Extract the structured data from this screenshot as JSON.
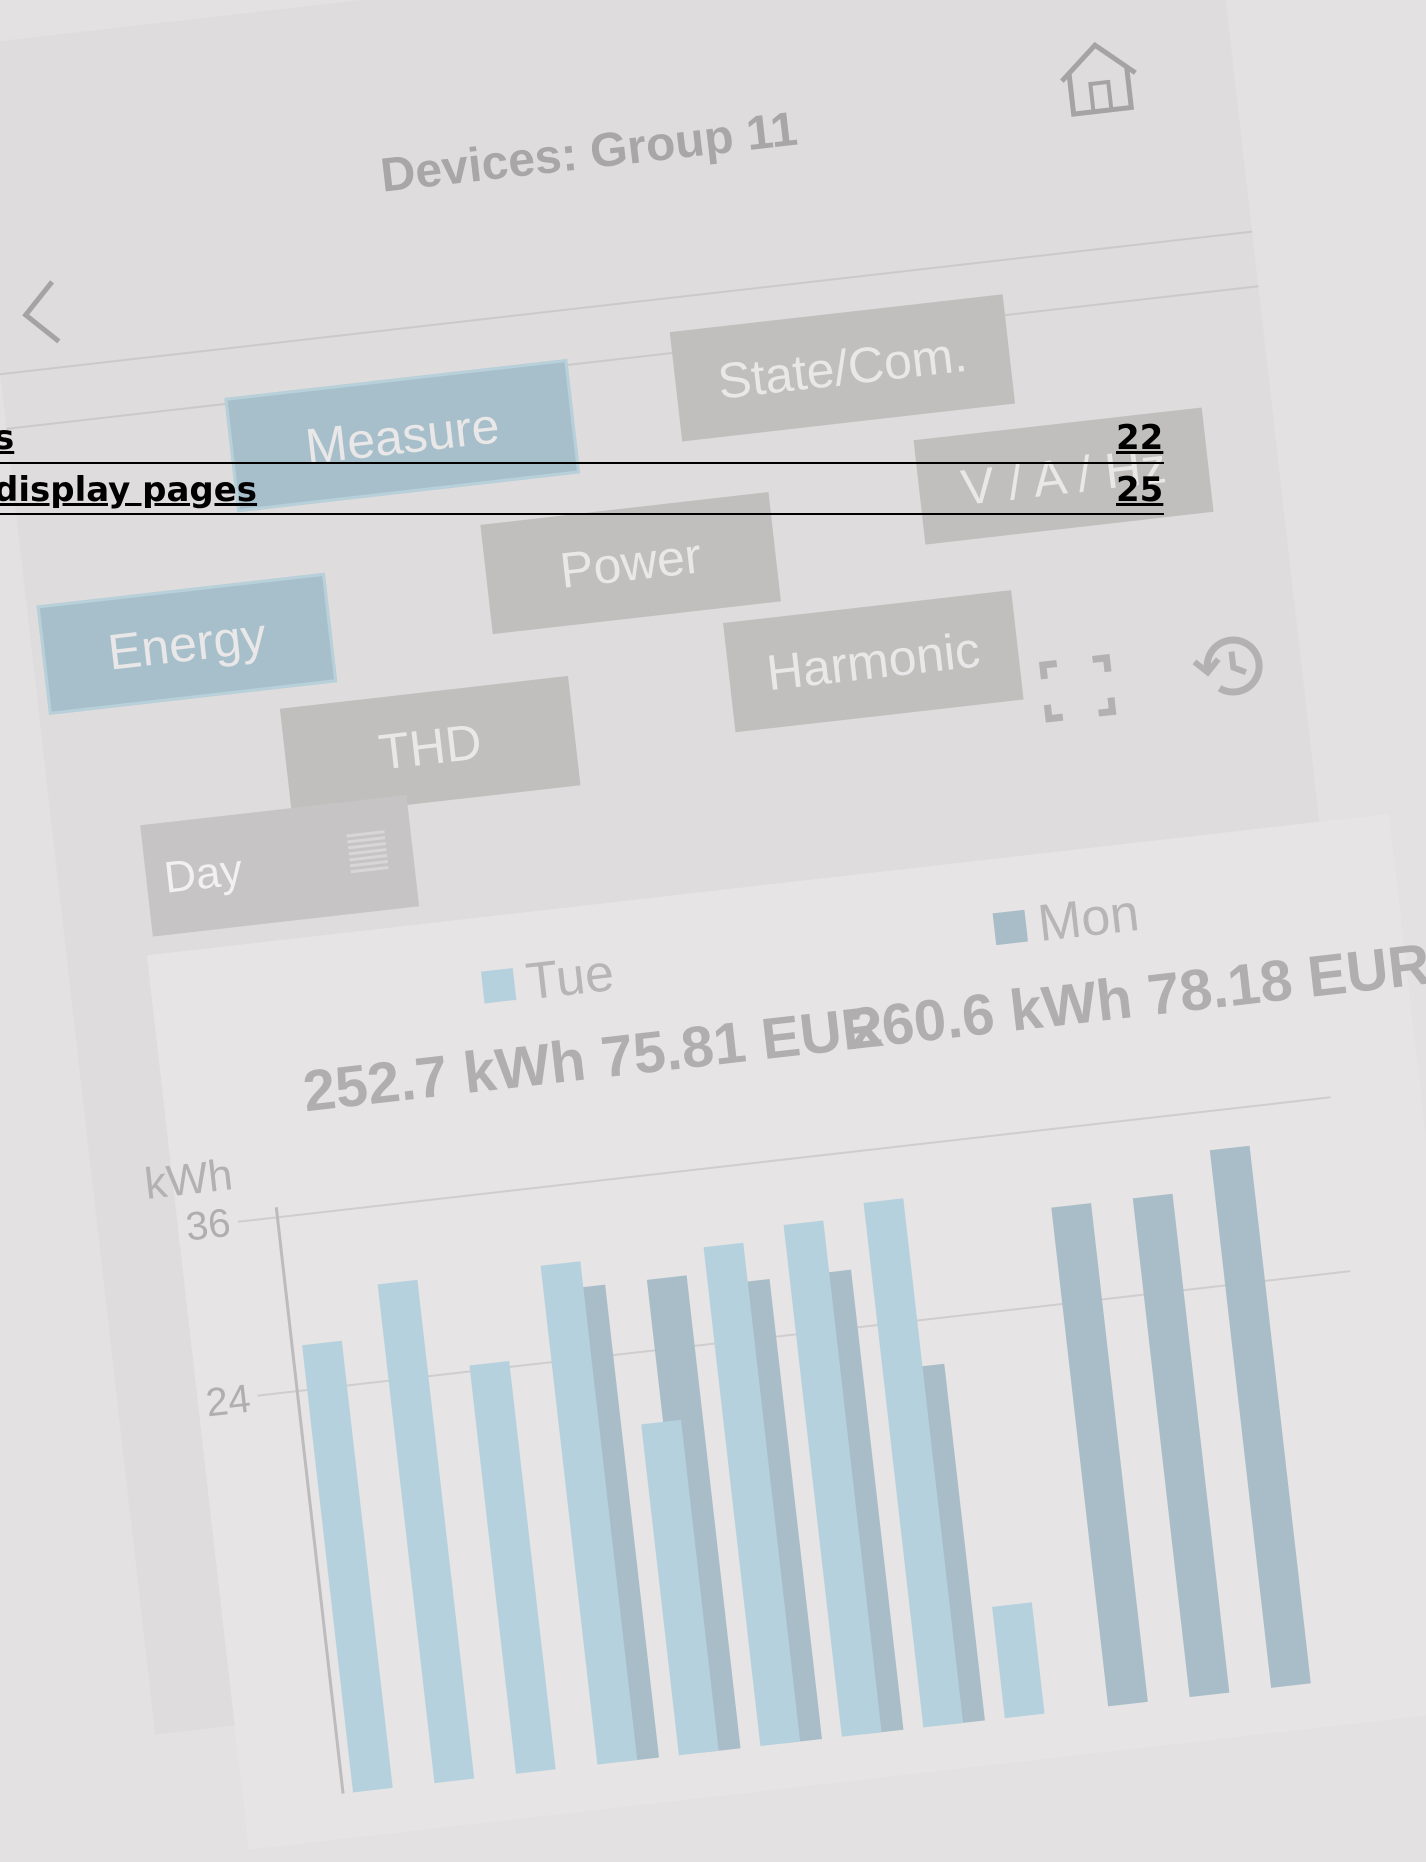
{
  "header": {
    "title": "Devices: Group 11",
    "back_icon": "chevron-left-icon",
    "home_icon": "home-icon"
  },
  "tabs": [
    {
      "label": "Measure",
      "active": true
    },
    {
      "label": "State/Com.",
      "active": false
    },
    {
      "label": "V / A / Hz",
      "active": false
    },
    {
      "label": "Power",
      "active": false
    },
    {
      "label": "Energy",
      "active": true
    },
    {
      "label": "Harmonic",
      "active": false
    },
    {
      "label": "THD",
      "active": false
    }
  ],
  "tools": {
    "fullscreen_icon": "fullscreen-icon",
    "history_icon": "history-icon"
  },
  "period": {
    "label": "Day",
    "icon": "list-icon"
  },
  "legend": [
    {
      "label": "Tue",
      "total": "252.7 kWh 75.81 EUR",
      "color": "#b5d1de"
    },
    {
      "label": "Mon",
      "total": "260.6 kWh 78.18 EUR",
      "color": "#a8bdc8"
    }
  ],
  "chart_data": {
    "type": "bar",
    "ylabel": "kWh",
    "yticks": [
      "36",
      "24"
    ],
    "series": [
      {
        "name": "Tue",
        "values": [
          30,
          34,
          27,
          34,
          21,
          34,
          35,
          36,
          4,
          0,
          0,
          0
        ]
      },
      {
        "name": "Mon",
        "values": [
          0,
          0,
          0,
          32,
          32,
          31,
          31,
          23,
          0,
          34,
          34,
          37
        ]
      }
    ]
  },
  "document_overlay": {
    "rows": [
      {
        "text": "s",
        "page": "22"
      },
      {
        "text": "display pages",
        "page": "25"
      }
    ]
  }
}
